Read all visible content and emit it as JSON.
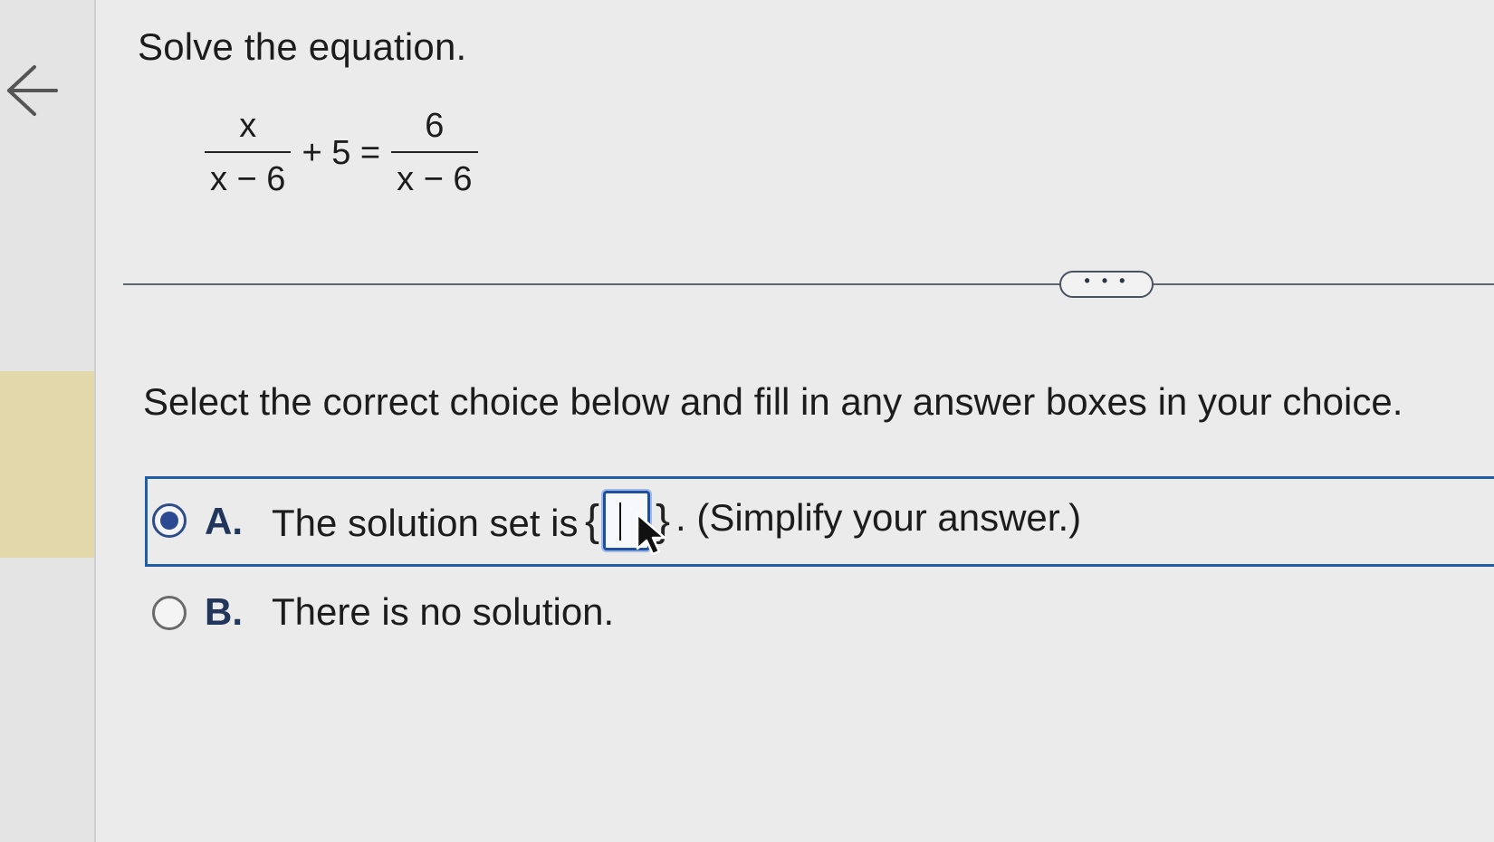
{
  "question": {
    "title": "Solve the equation."
  },
  "equation": {
    "left_numerator": "x",
    "left_denominator": "x − 6",
    "middle": "+ 5 =",
    "right_numerator": "6",
    "right_denominator": "x − 6"
  },
  "more_button": {
    "label": "• • •"
  },
  "instructions": "Select the correct choice below and fill in any answer boxes in your choice.",
  "choices": {
    "a": {
      "letter": "A.",
      "text_before": "The solution set is",
      "brace_open": "{",
      "brace_close": "}",
      "text_after": ". (Simplify your answer.)",
      "selected": true,
      "answer_value": ""
    },
    "b": {
      "letter": "B.",
      "text": "There is no solution.",
      "selected": false
    }
  },
  "icons": {
    "back": "arrow-left-icon",
    "cursor": "mouse-pointer-icon"
  },
  "colors": {
    "accent": "#1f5ea8",
    "radio_selected": "#2b4a92",
    "sidebar_highlight": "#e3d8ab"
  }
}
